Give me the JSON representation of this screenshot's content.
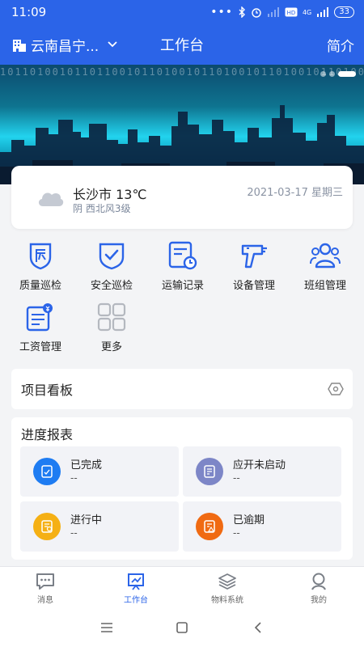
{
  "status_bar": {
    "time": "11:09",
    "network": "4G",
    "battery": "33"
  },
  "app_bar": {
    "project_name": "云南昌宁...",
    "title": "工作台",
    "intro_label": "简介"
  },
  "banner": {
    "binary_text": "10110100101101100101101001011010010110100101101001011010"
  },
  "weather": {
    "city_temp": "长沙市 13℃",
    "condition": "阴 西北风3级",
    "date": "2021-03-17 星期三"
  },
  "quick_actions": [
    {
      "label": "质量巡检",
      "icon": "quality-inspection-icon"
    },
    {
      "label": "安全巡检",
      "icon": "safety-inspection-icon"
    },
    {
      "label": "运输记录",
      "icon": "transport-record-icon"
    },
    {
      "label": "设备管理",
      "icon": "equipment-icon"
    },
    {
      "label": "班组管理",
      "icon": "team-icon"
    },
    {
      "label": "工资管理",
      "icon": "salary-icon"
    },
    {
      "label": "更多",
      "icon": "more-grid-icon"
    }
  ],
  "kanban": {
    "title": "项目看板"
  },
  "progress_report": {
    "title": "进度报表",
    "tiles": [
      {
        "label": "已完成",
        "value": "--",
        "color": "#1e7cf2"
      },
      {
        "label": "应开未启动",
        "value": "--",
        "color": "#7d86c7"
      },
      {
        "label": "进行中",
        "value": "--",
        "color": "#f5b014"
      },
      {
        "label": "已逾期",
        "value": "--",
        "color": "#f06a12"
      }
    ]
  },
  "tabs": [
    {
      "label": "消息",
      "icon": "message-icon",
      "active": false
    },
    {
      "label": "工作台",
      "icon": "workbench-icon",
      "active": true
    },
    {
      "label": "物料系统",
      "icon": "layers-icon",
      "active": false
    },
    {
      "label": "我的",
      "icon": "person-icon",
      "active": false
    }
  ],
  "colors": {
    "primary": "#2b64e8",
    "icon_blue": "#2b64e8",
    "icon_gray": "#9aa0a6"
  }
}
